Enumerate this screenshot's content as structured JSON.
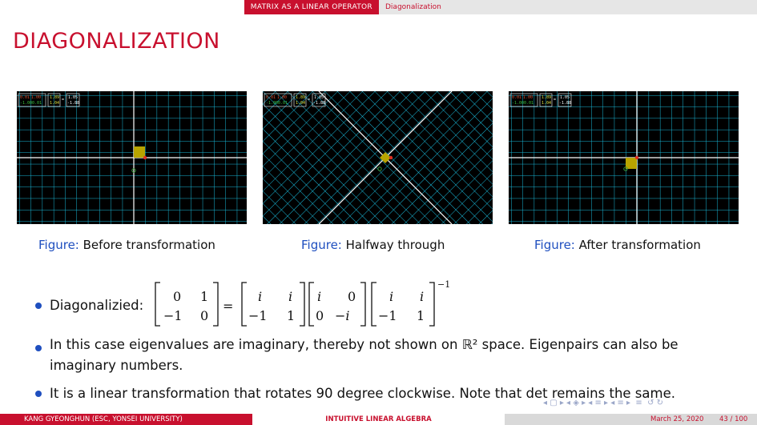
{
  "header": {
    "section": "MATRIX AS A LINEAR OPERATOR",
    "subsection": "Diagonalization"
  },
  "slide_title": "DIAGONALIZATION",
  "figures": [
    {
      "label": "Figure:",
      "caption": "Before transformation",
      "readout": [
        "0.01",
        "1.00",
        "-1.00",
        "0.01",
        "1.89",
        "1.04",
        "1.05",
        "-1.88"
      ]
    },
    {
      "label": "Figure:",
      "caption": "Halfway through",
      "readout": [
        "0.01",
        "1.00",
        "-1.00",
        "0.01",
        "1.89",
        "1.04",
        "1.05",
        "-1.88"
      ]
    },
    {
      "label": "Figure:",
      "caption": "After transformation",
      "readout": [
        "0.01",
        "1.00",
        "-1.00",
        "0.01",
        "1.89",
        "1.04",
        "1.05",
        "-1.88"
      ]
    }
  ],
  "bullets": {
    "diag_label": "Diagonalizied:",
    "b2": "In this case eigenvalues are imaginary, thereby not shown on ℝ² space. Eigenpairs can also be",
    "b2_cont": "imaginary numbers.",
    "b3": "It is a linear transformation that rotates 90 degree clockwise. Note that det remains the same."
  },
  "equation": {
    "lhs": [
      [
        "0",
        "1"
      ],
      [
        "−1",
        "0"
      ]
    ],
    "m1": [
      [
        "i",
        "i"
      ],
      [
        "−1",
        "1"
      ]
    ],
    "m2": [
      [
        "i",
        "0"
      ],
      [
        "0",
        "−i"
      ]
    ],
    "m3": [
      [
        "i",
        "i"
      ],
      [
        "−1",
        "1"
      ]
    ],
    "eq": "=",
    "exp": "−1"
  },
  "footer": {
    "author": "KANG GYEONGHUN  (ESC, YONSEI UNIVERSITY)",
    "short_title": "INTUITIVE LINEAR ALGEBRA",
    "date": "March 25, 2020",
    "page": "43 / 100"
  },
  "colors": {
    "accent": "#c8102e",
    "caption_label": "#1f4fbf",
    "grid": "#19b8d8"
  }
}
